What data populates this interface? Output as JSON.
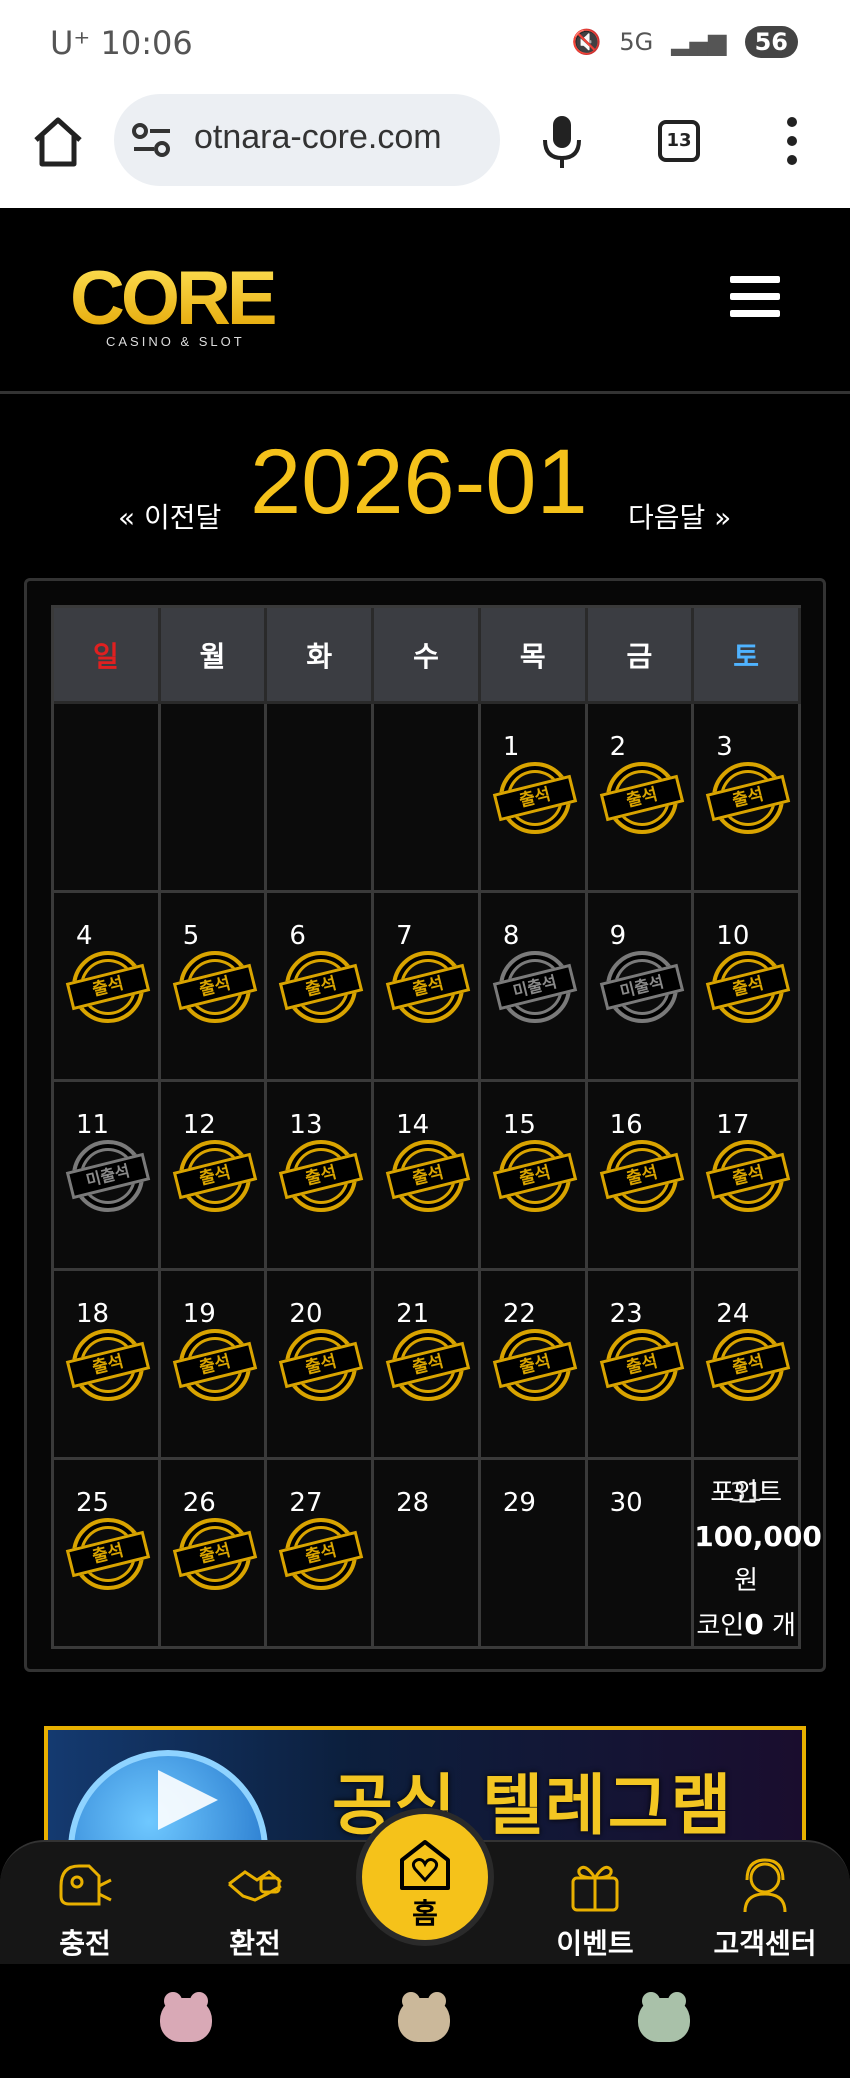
{
  "status": {
    "carrier": "U⁺",
    "time": "10:06",
    "network": "5G",
    "battery": "56"
  },
  "browser": {
    "url": "otnara-core.com",
    "tab_count": "13"
  },
  "site": {
    "logo_text": "CORE",
    "logo_sub": "CASINO & SLOT"
  },
  "calendar": {
    "prev_label": "« 이전달",
    "month": "2026-01",
    "next_label": "다음달 »",
    "weekdays": [
      "일",
      "월",
      "화",
      "수",
      "목",
      "금",
      "토"
    ],
    "stamp_attended": "출석",
    "stamp_missed": "미출석",
    "points": {
      "label": "포인트",
      "amount": "100,000",
      "unit": "원",
      "coin_label": "코인",
      "coin_value": "0",
      "coin_unit": "개"
    }
  },
  "banner": {
    "text": "공식 텔레그램"
  },
  "bottom_nav": {
    "charge": "충전",
    "exchange": "환전",
    "home": "홈",
    "event": "이벤트",
    "support": "고객센터"
  },
  "colors": {
    "accent": "#f5c21a",
    "sunday": "#e02020",
    "saturday": "#4fb3ff"
  }
}
